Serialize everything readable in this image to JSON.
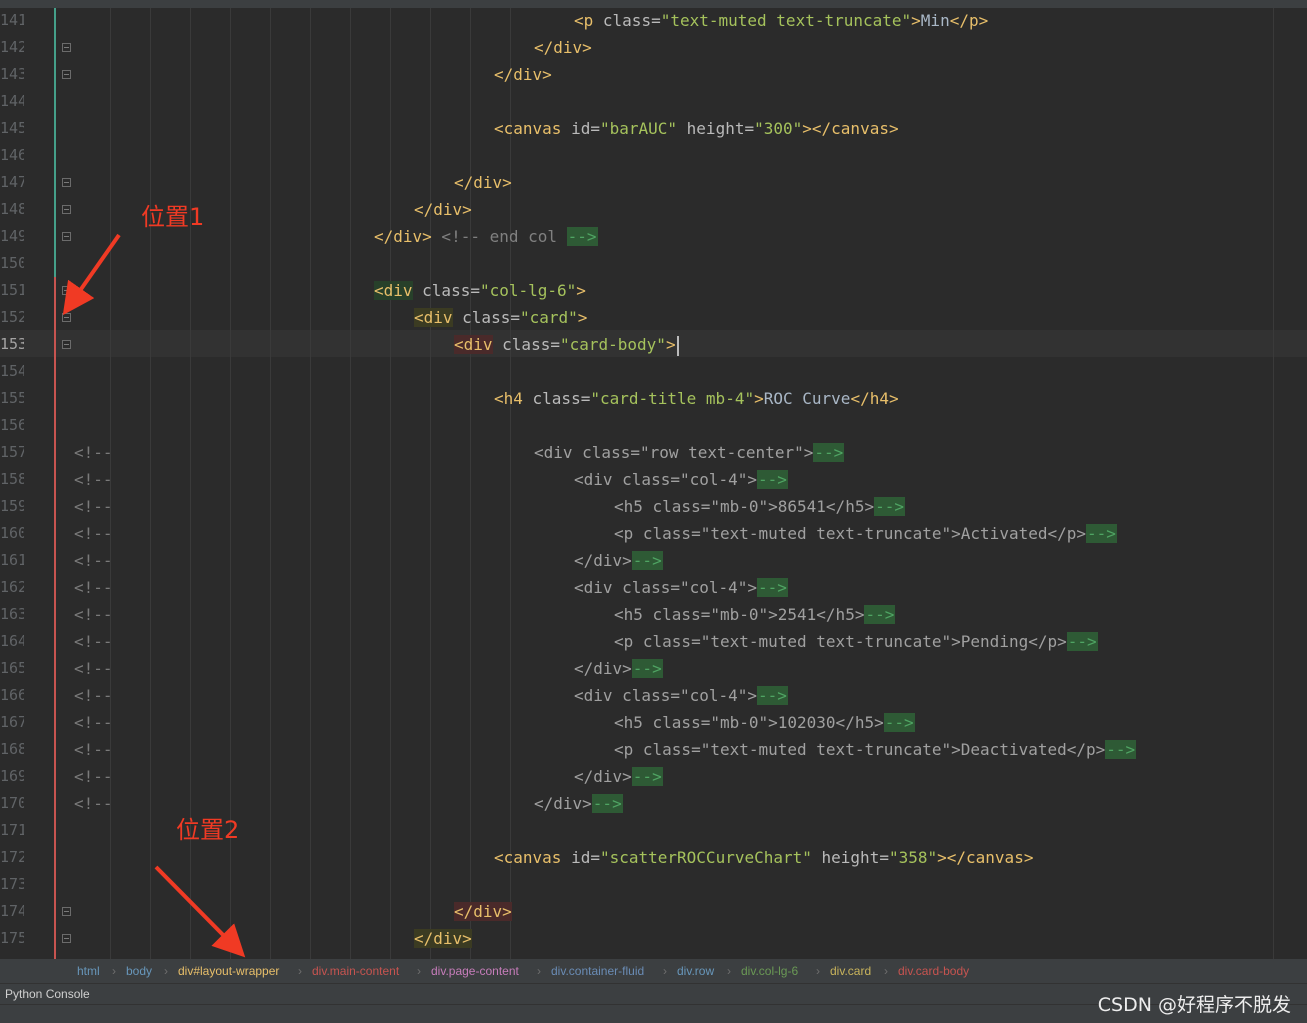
{
  "colors": {
    "editor_bg": "#2b2b2b",
    "tag": "#e8bf6a",
    "attribute": "#bababa",
    "string": "#a5c25c",
    "comment": "#808080",
    "annotation_red": "#f03a24",
    "gutter_green": "#45a08a",
    "gutter_red": "#c75450"
  },
  "gutter": {
    "line_numbers": [
      "141",
      "142",
      "143",
      "144",
      "145",
      "146",
      "147",
      "148",
      "149",
      "150",
      "151",
      "152",
      "153",
      "154",
      "155",
      "156",
      "157",
      "158",
      "159",
      "160",
      "161",
      "162",
      "163",
      "164",
      "165",
      "166",
      "167",
      "168",
      "169",
      "170",
      "171",
      "172",
      "173",
      "174",
      "175"
    ],
    "current_line": "153",
    "comment_marker": "<!--"
  },
  "code_lines": [
    {
      "n": "141",
      "parts": [
        [
          "tag",
          "<p "
        ],
        [
          "attr",
          "class="
        ],
        [
          "str",
          "\"text-muted text-truncate\""
        ],
        [
          "tag",
          ">"
        ],
        [
          "txt",
          "Min"
        ],
        [
          "tag",
          "</p>"
        ]
      ]
    },
    {
      "n": "142",
      "parts": [
        [
          "tag",
          "</div>"
        ]
      ]
    },
    {
      "n": "143",
      "parts": [
        [
          "tag",
          "</div>"
        ]
      ]
    },
    {
      "n": "144",
      "parts": []
    },
    {
      "n": "145",
      "parts": [
        [
          "tag",
          "<canvas "
        ],
        [
          "attr",
          "id="
        ],
        [
          "str",
          "\"barAUC\""
        ],
        [
          "attr",
          " height="
        ],
        [
          "str",
          "\"300\""
        ],
        [
          "tag",
          "></canvas>"
        ]
      ]
    },
    {
      "n": "146",
      "parts": []
    },
    {
      "n": "147",
      "parts": [
        [
          "tag",
          "</div>"
        ]
      ]
    },
    {
      "n": "148",
      "parts": [
        [
          "tag",
          "</div>"
        ]
      ]
    },
    {
      "n": "149",
      "parts": [
        [
          "tag",
          "</div>"
        ],
        [
          "cm",
          " <!-- end col "
        ],
        [
          "endcm",
          "-->"
        ]
      ]
    },
    {
      "n": "150",
      "parts": []
    },
    {
      "n": "151",
      "parts": [
        [
          "tag hl-g",
          "<div"
        ],
        [
          "attr",
          " class="
        ],
        [
          "str",
          "\"col-lg-6\""
        ],
        [
          "tag",
          ">"
        ]
      ]
    },
    {
      "n": "152",
      "parts": [
        [
          "tag hl-y",
          "<div"
        ],
        [
          "attr",
          " class="
        ],
        [
          "str",
          "\"card\""
        ],
        [
          "tag",
          ">"
        ]
      ]
    },
    {
      "n": "153",
      "parts": [
        [
          "tag hl-r",
          "<div"
        ],
        [
          "attr",
          " class="
        ],
        [
          "str",
          "\"card-body\""
        ],
        [
          "tag",
          ">"
        ]
      ]
    },
    {
      "n": "154",
      "parts": []
    },
    {
      "n": "155",
      "parts": [
        [
          "tag",
          "<h4 "
        ],
        [
          "attr",
          "class="
        ],
        [
          "str",
          "\"card-title mb-4\""
        ],
        [
          "tag",
          ">"
        ],
        [
          "txt",
          "ROC Curve"
        ],
        [
          "tag",
          "</h4>"
        ]
      ]
    },
    {
      "n": "156",
      "parts": []
    },
    {
      "n": "157",
      "parts": [
        [
          "cmt",
          "<div class=\"row text-center\">"
        ],
        [
          "endcm",
          "-->"
        ]
      ]
    },
    {
      "n": "158",
      "parts": [
        [
          "cmt",
          "<div class=\"col-4\">"
        ],
        [
          "endcm",
          "-->"
        ]
      ]
    },
    {
      "n": "159",
      "parts": [
        [
          "cmt",
          "<h5 class=\"mb-0\">86541</h5>"
        ],
        [
          "endcm",
          "-->"
        ]
      ]
    },
    {
      "n": "160",
      "parts": [
        [
          "cmt",
          "<p class=\"text-muted text-truncate\">Activated</p>"
        ],
        [
          "endcm",
          "-->"
        ]
      ]
    },
    {
      "n": "161",
      "parts": [
        [
          "cmt",
          "</div>"
        ],
        [
          "endcm",
          "-->"
        ]
      ]
    },
    {
      "n": "162",
      "parts": [
        [
          "cmt",
          "<div class=\"col-4\">"
        ],
        [
          "endcm",
          "-->"
        ]
      ]
    },
    {
      "n": "163",
      "parts": [
        [
          "cmt",
          "<h5 class=\"mb-0\">2541</h5>"
        ],
        [
          "endcm",
          "-->"
        ]
      ]
    },
    {
      "n": "164",
      "parts": [
        [
          "cmt",
          "<p class=\"text-muted text-truncate\">Pending</p>"
        ],
        [
          "endcm",
          "-->"
        ]
      ]
    },
    {
      "n": "165",
      "parts": [
        [
          "cmt",
          "</div>"
        ],
        [
          "endcm",
          "-->"
        ]
      ]
    },
    {
      "n": "166",
      "parts": [
        [
          "cmt",
          "<div class=\"col-4\">"
        ],
        [
          "endcm",
          "-->"
        ]
      ]
    },
    {
      "n": "167",
      "parts": [
        [
          "cmt",
          "<h5 class=\"mb-0\">102030</h5>"
        ],
        [
          "endcm",
          "-->"
        ]
      ]
    },
    {
      "n": "168",
      "parts": [
        [
          "cmt",
          "<p class=\"text-muted text-truncate\">Deactivated</p>"
        ],
        [
          "endcm",
          "-->"
        ]
      ]
    },
    {
      "n": "169",
      "parts": [
        [
          "cmt",
          "</div>"
        ],
        [
          "endcm",
          "-->"
        ]
      ]
    },
    {
      "n": "170",
      "parts": [
        [
          "cmt",
          "</div>"
        ],
        [
          "endcm",
          "-->"
        ]
      ]
    },
    {
      "n": "171",
      "parts": []
    },
    {
      "n": "172",
      "parts": [
        [
          "tag",
          "<canvas "
        ],
        [
          "attr",
          "id="
        ],
        [
          "str",
          "\"scatterROCCurveChart\""
        ],
        [
          "attr",
          " height="
        ],
        [
          "str",
          "\"358\""
        ],
        [
          "tag",
          "></canvas>"
        ]
      ]
    },
    {
      "n": "173",
      "parts": []
    },
    {
      "n": "174",
      "parts": [
        [
          "tag hl-r",
          "</div>"
        ]
      ]
    },
    {
      "n": "175",
      "parts": [
        [
          "tag hl-y",
          "</div>"
        ]
      ]
    }
  ],
  "annotations": {
    "label_1": "位置1",
    "label_2": "位置2"
  },
  "breadcrumb": [
    {
      "label": "html",
      "color": "#6897bb"
    },
    {
      "label": "body",
      "color": "#6897bb"
    },
    {
      "label": "div#layout-wrapper",
      "color": "#e8bf6a"
    },
    {
      "label": "div.main-content",
      "color": "#c75450"
    },
    {
      "label": "div.page-content",
      "color": "#c77dbb"
    },
    {
      "label": "div.container-fluid",
      "color": "#6a8cb5"
    },
    {
      "label": "div.row",
      "color": "#6897bb"
    },
    {
      "label": "div.col-lg-6",
      "color": "#6a9955"
    },
    {
      "label": "div.card",
      "color": "#c9b45c"
    },
    {
      "label": "div.card-body",
      "color": "#c75450"
    }
  ],
  "bottom_panel": {
    "tab_label": "Python Console",
    "watermark": "CSDN @好程序不脱发"
  }
}
